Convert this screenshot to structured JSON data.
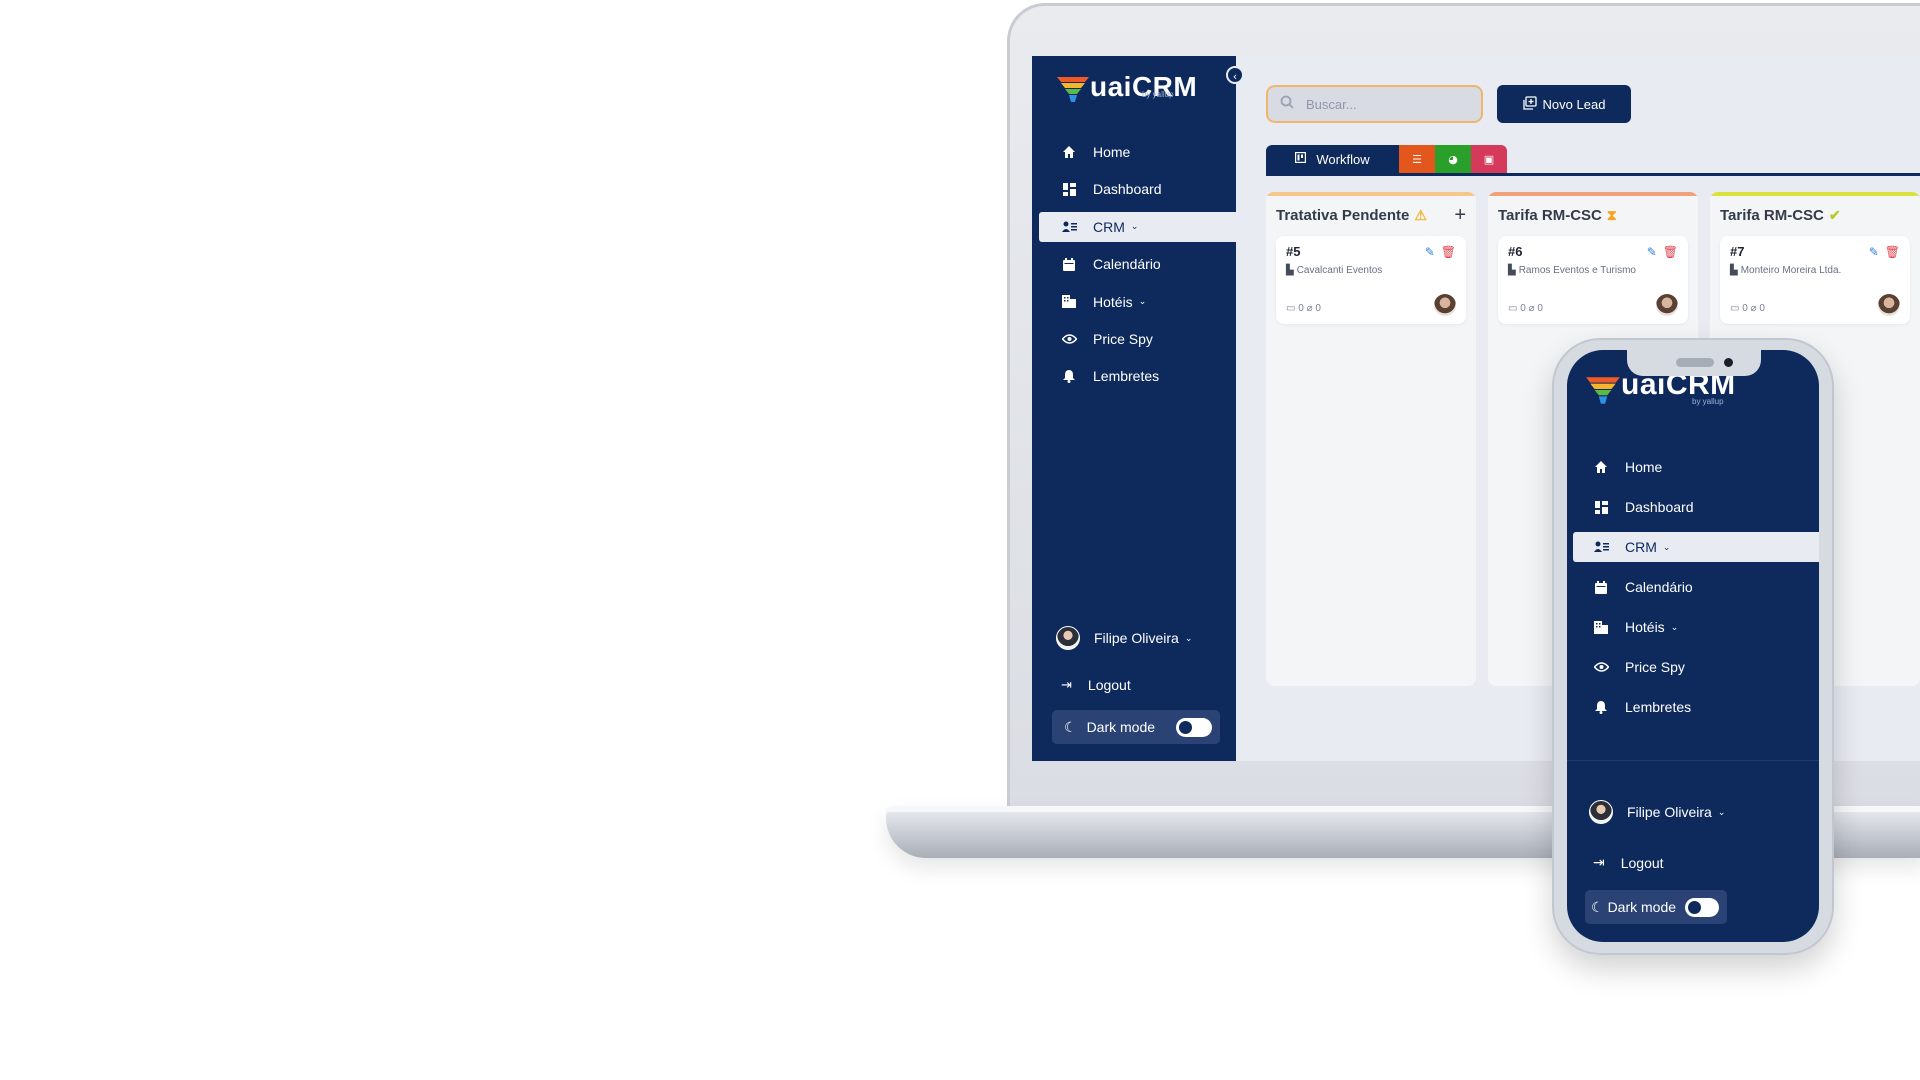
{
  "app": {
    "logo_text": "uaiCRM",
    "logo_sub": "by yallup"
  },
  "colors": {
    "sidebar_bg": "#0e2a5c",
    "content_bg": "#e8ebf2",
    "search_border": "#f2b66a",
    "tab_list": "#e4571c",
    "tab_chart": "#2aa02a",
    "tab_calendar": "#d63a5a",
    "col1_top": "#f5c78a",
    "col2_top": "#f2a07a",
    "col3_top": "#d8e23a"
  },
  "sidebar": {
    "items": [
      {
        "label": "Home",
        "icon": "home-icon"
      },
      {
        "label": "Dashboard",
        "icon": "dashboard-icon"
      },
      {
        "label": "CRM",
        "icon": "crm-icon",
        "active": true,
        "has_chevron": true
      },
      {
        "label": "Calendário",
        "icon": "calendar-icon"
      },
      {
        "label": "Hotéis",
        "icon": "hotel-icon",
        "has_chevron": true
      },
      {
        "label": "Price Spy",
        "icon": "eye-icon"
      },
      {
        "label": "Lembretes",
        "icon": "bell-icon"
      }
    ],
    "user_name": "Filipe Oliveira",
    "logout_label": "Logout",
    "dark_mode_label": "Dark mode",
    "dark_mode_on": false
  },
  "topbar": {
    "search_placeholder": "Buscar...",
    "new_lead_label": "Novo Lead"
  },
  "tabs": {
    "workflow_label": "Workflow"
  },
  "kanban": {
    "columns": [
      {
        "title": "Tratativa Pendente",
        "status_icon": "warning-icon",
        "has_add": true,
        "cards": [
          {
            "id": "#5",
            "company": "Cavalcanti Eventos",
            "comments": "0",
            "attachments": "0"
          }
        ]
      },
      {
        "title": "Tarifa RM-CSC",
        "status_icon": "hourglass-icon",
        "cards": [
          {
            "id": "#6",
            "company": "Ramos Eventos e Turismo",
            "comments": "0",
            "attachments": "0"
          }
        ]
      },
      {
        "title": "Tarifa RM-CSC",
        "status_icon": "check-circle-icon",
        "cards": [
          {
            "id": "#7",
            "company": "Monteiro Moreira Ltda.",
            "comments": "0",
            "attachments": "0"
          }
        ]
      }
    ]
  },
  "phone": {
    "logo_text": "uaiCRM",
    "logo_sub": "by yallup",
    "items": [
      {
        "label": "Home"
      },
      {
        "label": "Dashboard"
      },
      {
        "label": "CRM",
        "active": true
      },
      {
        "label": "Calendário"
      },
      {
        "label": "Hotéis"
      },
      {
        "label": "Price Spy"
      },
      {
        "label": "Lembretes"
      }
    ],
    "user_name": "Filipe Oliveira",
    "logout_label": "Logout",
    "dark_mode_label": "Dark mode"
  }
}
